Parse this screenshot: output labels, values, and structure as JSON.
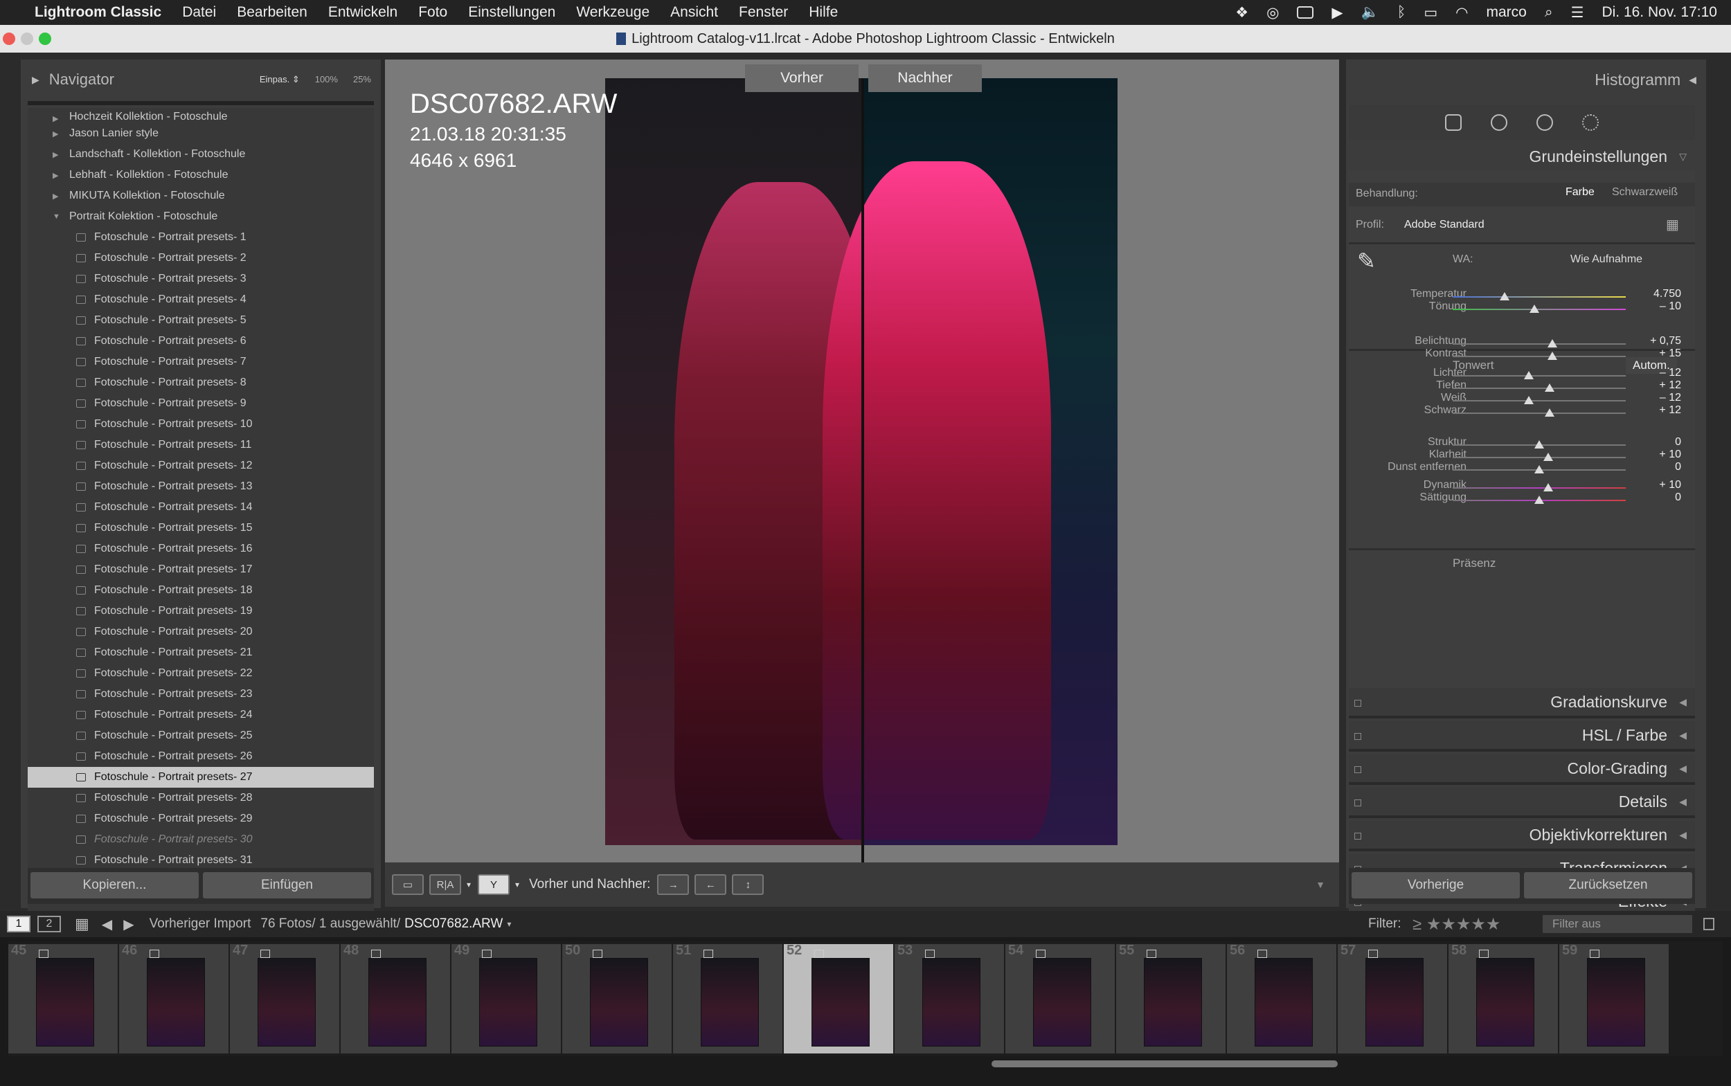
{
  "menubar": {
    "app": "Lightroom Classic",
    "items": [
      "Datei",
      "Bearbeiten",
      "Entwickeln",
      "Foto",
      "Einstellungen",
      "Werkzeuge",
      "Ansicht",
      "Fenster",
      "Hilfe"
    ],
    "user": "marco",
    "datetime": "Di. 16. Nov.  17:10"
  },
  "window": {
    "title": "Lightroom Catalog-v11.lrcat - Adobe Photoshop Lightroom Classic - Entwickeln"
  },
  "left": {
    "navigator": {
      "title": "Navigator",
      "zoom": [
        "Einpas. ⇕",
        "100%",
        "25%"
      ]
    },
    "folders": [
      {
        "label": "Hochzeit Kollektion - Fotoschule",
        "expanded": false
      },
      {
        "label": "Jason Lanier style",
        "expanded": false
      },
      {
        "label": "Landschaft - Kollektion - Fotoschule",
        "expanded": false
      },
      {
        "label": "Lebhaft - Kollektion - Fotoschule",
        "expanded": false
      },
      {
        "label": "MIKUTA Kollektion - Fotoschule",
        "expanded": false
      },
      {
        "label": "Portrait Kolektion - Fotoschule",
        "expanded": true
      }
    ],
    "presets": [
      "Fotoschule - Portrait presets- 1",
      "Fotoschule - Portrait presets- 2",
      "Fotoschule - Portrait presets- 3",
      "Fotoschule - Portrait presets- 4",
      "Fotoschule - Portrait presets- 5",
      "Fotoschule - Portrait presets- 6",
      "Fotoschule - Portrait presets- 7",
      "Fotoschule - Portrait presets- 8",
      "Fotoschule - Portrait presets- 9",
      "Fotoschule - Portrait presets- 10",
      "Fotoschule - Portrait presets- 11",
      "Fotoschule - Portrait presets- 12",
      "Fotoschule - Portrait presets- 13",
      "Fotoschule - Portrait presets- 14",
      "Fotoschule - Portrait presets- 15",
      "Fotoschule - Portrait presets- 16",
      "Fotoschule - Portrait presets- 17",
      "Fotoschule - Portrait presets- 18",
      "Fotoschule - Portrait presets- 19",
      "Fotoschule - Portrait presets- 20",
      "Fotoschule - Portrait presets- 21",
      "Fotoschule - Portrait presets- 22",
      "Fotoschule - Portrait presets- 23",
      "Fotoschule - Portrait presets- 24",
      "Fotoschule - Portrait presets- 25",
      "Fotoschule - Portrait presets- 26",
      "Fotoschule - Portrait presets- 27",
      "Fotoschule - Portrait presets- 28",
      "Fotoschule - Portrait presets- 29",
      "Fotoschule - Portrait presets- 30",
      "Fotoschule - Portrait presets- 31"
    ],
    "selected_preset": "Fotoschule - Portrait presets- 27",
    "dimmed_preset": "Fotoschule - Portrait presets- 30",
    "buttons": {
      "copy": "Kopieren...",
      "paste": "Einfügen"
    }
  },
  "center": {
    "before_label": "Vorher",
    "after_label": "Nachher",
    "filename": "DSC07682.ARW",
    "datetime": "21.03.18 20:31:35",
    "dimensions": "4646 x 6961",
    "toolbar_label": "Vorher und Nachher:",
    "toolbar_ra": "R|A"
  },
  "right": {
    "histogram": "Histogramm",
    "section_basic": "Grundeinstellungen",
    "treatment": {
      "label": "Behandlung:",
      "color": "Farbe",
      "bw": "Schwarzweiß"
    },
    "profile": {
      "label": "Profil:",
      "value": "Adobe Standard"
    },
    "wb": {
      "label": "WA:",
      "value": "Wie Aufnahme"
    },
    "tone_group": "Tonwert",
    "auto": "Autom.",
    "presence_group": "Präsenz",
    "sliders": [
      {
        "label": "Temperatur",
        "value": "4.750",
        "pos": 0.3
      },
      {
        "label": "Tönung",
        "value": "– 10",
        "pos": 0.47
      },
      {
        "label": "Belichtung",
        "value": "+ 0,75",
        "pos": 0.575
      },
      {
        "label": "Kontrast",
        "value": "+ 15",
        "pos": 0.575
      },
      {
        "label": "Lichter",
        "value": "– 12",
        "pos": 0.44
      },
      {
        "label": "Tiefen",
        "value": "+ 12",
        "pos": 0.56
      },
      {
        "label": "Weiß",
        "value": "– 12",
        "pos": 0.44
      },
      {
        "label": "Schwarz",
        "value": "+ 12",
        "pos": 0.56
      },
      {
        "label": "Struktur",
        "value": "0",
        "pos": 0.5
      },
      {
        "label": "Klarheit",
        "value": "+ 10",
        "pos": 0.55
      },
      {
        "label": "Dunst entfernen",
        "value": "0",
        "pos": 0.5
      },
      {
        "label": "Dynamik",
        "value": "+ 10",
        "pos": 0.55
      },
      {
        "label": "Sättigung",
        "value": "0",
        "pos": 0.5
      }
    ],
    "sections": [
      "Gradationskurve",
      "HSL / Farbe",
      "Color-Grading",
      "Details",
      "Objektivkorrekturen",
      "Transformieren",
      "Effekte"
    ],
    "buttons": {
      "previous": "Vorherige",
      "reset": "Zurücksetzen"
    }
  },
  "filmstrip_bar": {
    "page1": "1",
    "page2": "2",
    "source": "Vorheriger Import",
    "count": "76 Fotos/ 1 ausgewählt/",
    "file": "DSC07682.ARW",
    "filter_label": "Filter:",
    "filter_value": "Filter aus"
  },
  "filmstrip": {
    "numbers": [
      "45",
      "46",
      "47",
      "48",
      "49",
      "50",
      "51",
      "52",
      "53",
      "54",
      "55",
      "56",
      "57",
      "58",
      "59"
    ],
    "selected": "52"
  }
}
